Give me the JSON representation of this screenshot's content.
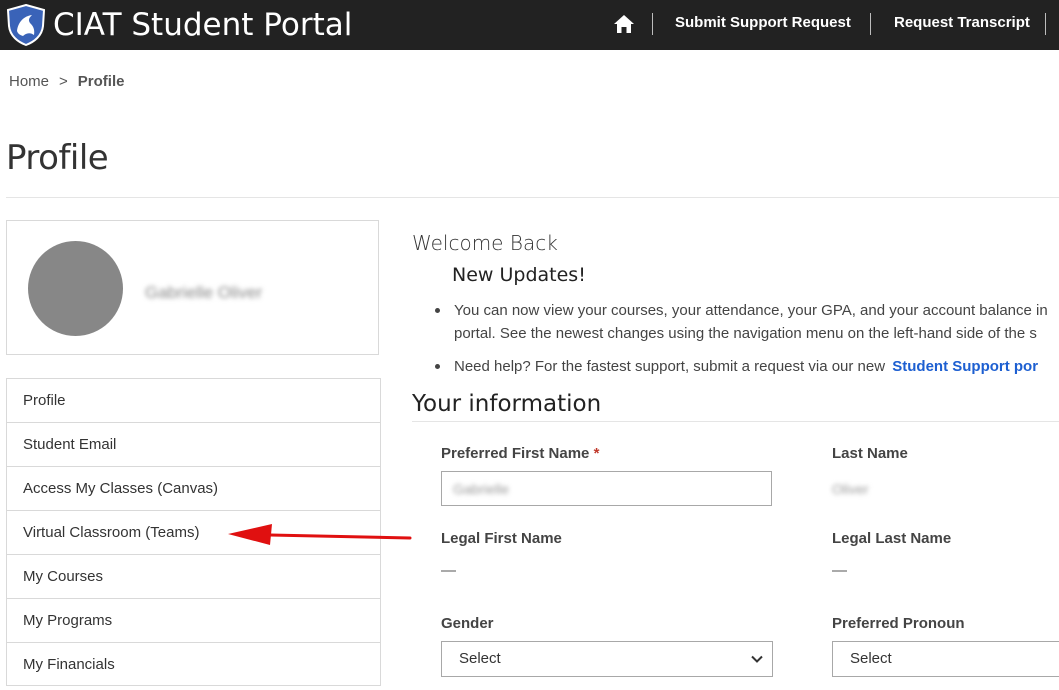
{
  "header": {
    "brand": "CIAT Student Portal",
    "logo_icon": "shield-logo-icon",
    "home_icon": "home-icon",
    "nav_links": [
      "Submit Support Request",
      "Request Transcript"
    ]
  },
  "breadcrumb": {
    "home": "Home",
    "separator": ">",
    "current": "Profile"
  },
  "page": {
    "title": "Profile"
  },
  "profile_card": {
    "name": "Gabrielle Oliver"
  },
  "sidebar": {
    "items": [
      {
        "label": "Profile"
      },
      {
        "label": "Student Email"
      },
      {
        "label": "Access My Classes (Canvas)"
      },
      {
        "label": "Virtual Classroom (Teams)"
      },
      {
        "label": "My Courses"
      },
      {
        "label": "My Programs"
      },
      {
        "label": "My Financials"
      }
    ]
  },
  "main": {
    "welcome": "Welcome Back",
    "updates_title": "New Updates!",
    "bullet1_line1": "You can now view your courses, your attendance, your GPA, and your account balance in",
    "bullet1_line2": "portal. See the newest changes using the navigation menu on the left-hand side of the s",
    "bullet2_text": "Need help? For the fastest support, submit a request via our new",
    "bullet2_link": "Student Support por",
    "section_title": "Your information"
  },
  "form": {
    "preferred_first_name_label": "Preferred First Name",
    "required_marker": "*",
    "preferred_first_name_value": "Gabrielle",
    "last_name_label": "Last Name",
    "last_name_value": "Oliver",
    "legal_first_name_label": "Legal First Name",
    "legal_first_name_value": "—",
    "legal_last_name_label": "Legal Last Name",
    "legal_last_name_value": "—",
    "gender_label": "Gender",
    "gender_value": "Select",
    "pronoun_label": "Preferred Pronoun",
    "pronoun_value": "Select"
  },
  "colors": {
    "topbar": "#222222",
    "link_blue": "#1d5fd1",
    "annotation_arrow": "#e01010",
    "avatar": "#878787"
  }
}
